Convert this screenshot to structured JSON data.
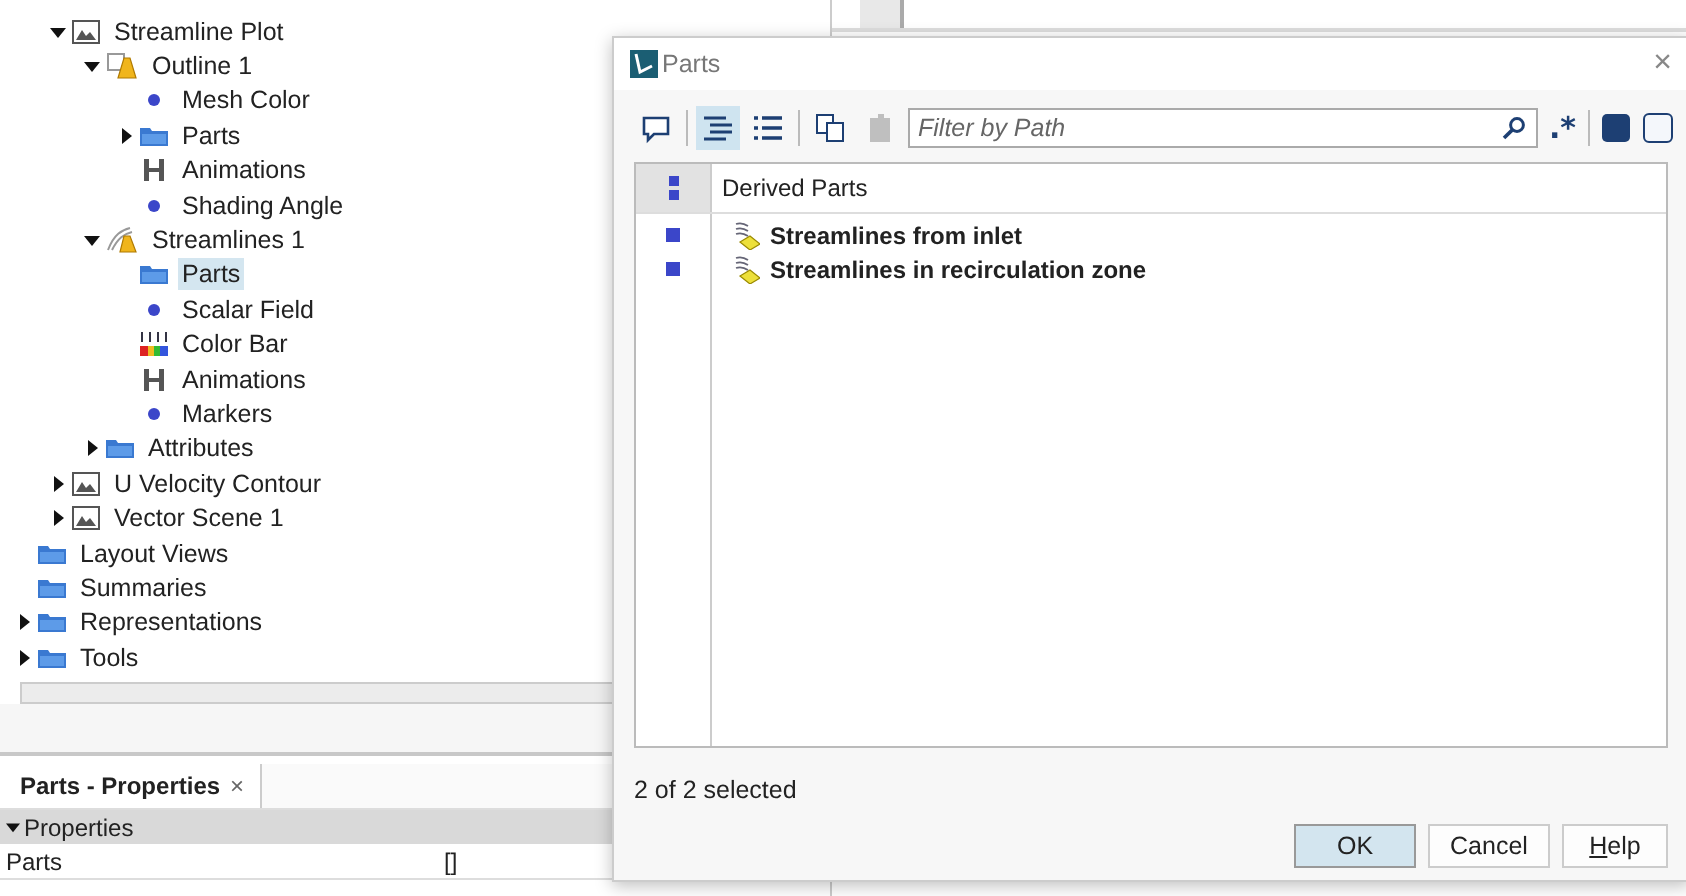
{
  "tree": {
    "continued_children": [
      {
        "label": "Streamline Plot",
        "kind": "scene",
        "expanded": true,
        "selected": false,
        "children": [
          {
            "label": "Outline 1",
            "kind": "outline",
            "expanded": true,
            "selected": false,
            "children": [
              {
                "label": "Mesh Color",
                "kind": "dot",
                "selected": false
              },
              {
                "label": "Parts",
                "kind": "folder",
                "expanded": false,
                "selected": false
              },
              {
                "label": "Animations",
                "kind": "animation",
                "selected": false
              },
              {
                "label": "Shading Angle",
                "kind": "dot",
                "selected": false
              }
            ]
          },
          {
            "label": "Streamlines 1",
            "kind": "streamline",
            "expanded": true,
            "selected": false,
            "children": [
              {
                "label": "Parts",
                "kind": "folder",
                "selected": true
              },
              {
                "label": "Scalar Field",
                "kind": "dot",
                "selected": false
              },
              {
                "label": "Color Bar",
                "kind": "colorbar",
                "selected": false
              },
              {
                "label": "Animations",
                "kind": "animation",
                "selected": false
              },
              {
                "label": "Markers",
                "kind": "dot",
                "selected": false
              }
            ]
          },
          {
            "label": "Attributes",
            "kind": "folder",
            "expanded": false,
            "selected": false
          }
        ]
      },
      {
        "label": "U Velocity Contour",
        "kind": "scene",
        "expanded": false,
        "selected": false
      },
      {
        "label": "Vector Scene 1",
        "kind": "scene",
        "expanded": false,
        "selected": false
      }
    ],
    "items": [
      {
        "label": "Layout Views",
        "kind": "folder",
        "selected": false
      },
      {
        "label": "Summaries",
        "kind": "folder",
        "selected": false
      },
      {
        "label": "Representations",
        "kind": "folder",
        "expanded": false,
        "selected": false
      },
      {
        "label": "Tools",
        "kind": "folder",
        "expanded": false,
        "selected": false
      }
    ]
  },
  "properties_panel": {
    "tab": "Parts - Properties",
    "tab_close": "×",
    "section": "Properties",
    "section_expanded": true,
    "rows": [
      {
        "name": "Parts",
        "value": "[]"
      }
    ]
  },
  "dialog": {
    "title": "Parts",
    "close": "×",
    "toolbar": [
      {
        "kind": "comment",
        "selected": false,
        "disabled": false
      },
      {
        "kind": "tree",
        "selected": true,
        "disabled": false
      },
      {
        "kind": "list",
        "selected": false,
        "disabled": false
      },
      {
        "kind": "copy",
        "selected": false,
        "disabled": false
      },
      {
        "kind": "paste",
        "selected": false,
        "disabled": true
      }
    ],
    "filter": {
      "placeholder": "Filter by Path"
    },
    "regex_toggle": ".*",
    "column": "Derived Parts",
    "rows": [
      {
        "label": "Streamlines from inlet",
        "selected": true
      },
      {
        "label": "Streamlines in recirculation zone",
        "selected": true
      }
    ],
    "status": "2 of 2 selected",
    "buttons": [
      {
        "label": "OK",
        "default": true
      },
      {
        "label": "Cancel",
        "default": false
      },
      {
        "label": "Help",
        "default": false
      }
    ]
  }
}
